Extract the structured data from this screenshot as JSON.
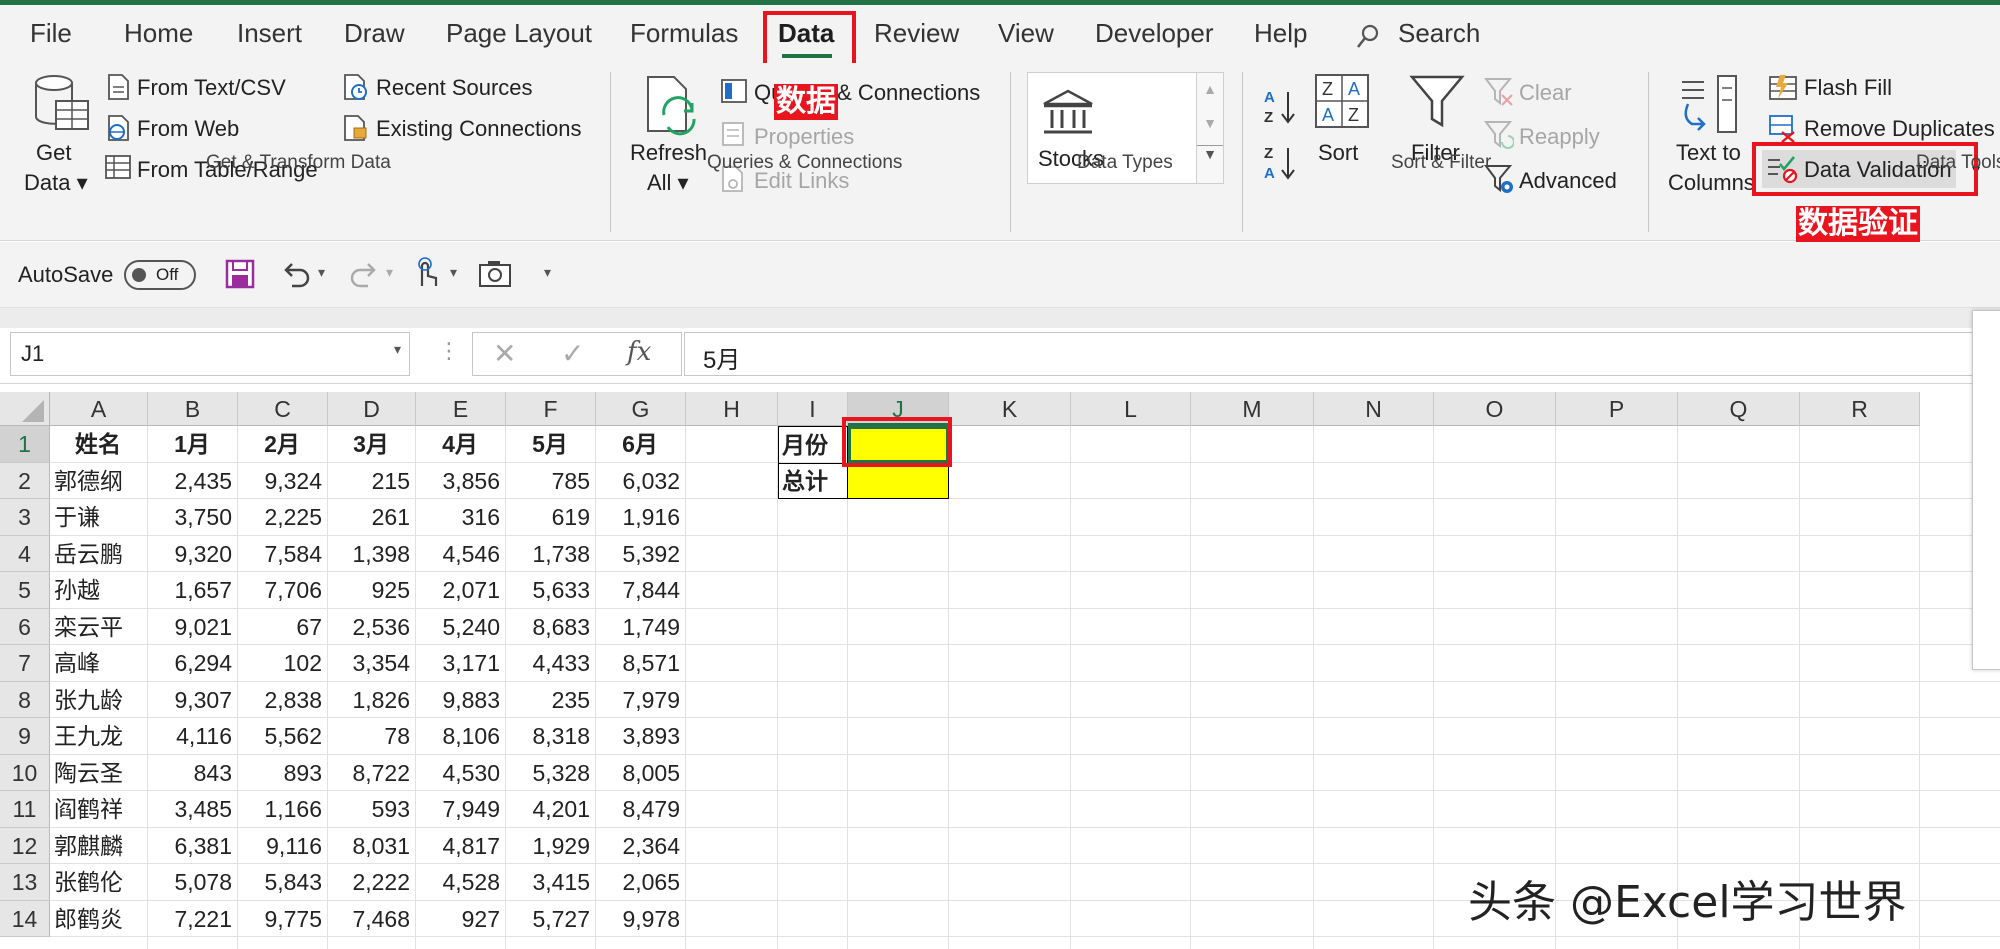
{
  "tabs": [
    "File",
    "Home",
    "Insert",
    "Draw",
    "Page Layout",
    "Formulas",
    "Data",
    "Review",
    "View",
    "Developer",
    "Help",
    "Search"
  ],
  "annotations": {
    "data_tab": "数据",
    "data_validation": "数据验证"
  },
  "ribbon": {
    "get_transform": {
      "get_data_1": "Get",
      "get_data_2": "Data ▾",
      "from_text_csv": "From Text/CSV",
      "from_web": "From Web",
      "from_table_range": "From Table/Range",
      "recent_sources": "Recent Sources",
      "existing_connections": "Existing Connections",
      "label": "Get & Transform Data"
    },
    "queries": {
      "refresh_1": "Refresh",
      "refresh_2": "All ▾",
      "queries_connections": "Queries & Connections",
      "properties": "Properties",
      "edit_links": "Edit Links",
      "label": "Queries & Connections"
    },
    "data_types": {
      "stocks": "Stocks",
      "label": "Data Types"
    },
    "sort_filter": {
      "sort": "Sort",
      "filter": "Filter",
      "clear": "Clear",
      "reapply": "Reapply",
      "advanced": "Advanced",
      "label": "Sort & Filter"
    },
    "data_tools": {
      "text_to_1": "Text to",
      "text_to_2": "Columns",
      "flash_fill": "Flash Fill",
      "remove_duplicates": "Remove Duplicates",
      "data_validation": "Data Validation",
      "label": "Data Tools"
    }
  },
  "qat": {
    "autosave": "AutoSave",
    "toggle": "Off"
  },
  "formula_bar": {
    "name_box": "J1",
    "formula": "5月",
    "fx": "fx"
  },
  "columns": [
    "A",
    "B",
    "C",
    "D",
    "E",
    "F",
    "G",
    "H",
    "I",
    "J",
    "K",
    "L",
    "M",
    "N",
    "O",
    "P",
    "Q",
    "R"
  ],
  "rows": [
    "1",
    "2",
    "3",
    "4",
    "5",
    "6",
    "7",
    "8",
    "9",
    "10",
    "11",
    "12",
    "13",
    "14"
  ],
  "table": {
    "headers": [
      "姓名",
      "1月",
      "2月",
      "3月",
      "4月",
      "5月",
      "6月"
    ],
    "data": [
      [
        "郭德纲",
        "2,435",
        "9,324",
        "215",
        "3,856",
        "785",
        "6,032"
      ],
      [
        "于谦",
        "3,750",
        "2,225",
        "261",
        "316",
        "619",
        "1,916"
      ],
      [
        "岳云鹏",
        "9,320",
        "7,584",
        "1,398",
        "4,546",
        "1,738",
        "5,392"
      ],
      [
        "孙越",
        "1,657",
        "7,706",
        "925",
        "2,071",
        "5,633",
        "7,844"
      ],
      [
        "栾云平",
        "9,021",
        "67",
        "2,536",
        "5,240",
        "8,683",
        "1,749"
      ],
      [
        "高峰",
        "6,294",
        "102",
        "3,354",
        "3,171",
        "4,433",
        "8,571"
      ],
      [
        "张九龄",
        "9,307",
        "2,838",
        "1,826",
        "9,883",
        "235",
        "7,979"
      ],
      [
        "王九龙",
        "4,116",
        "5,562",
        "78",
        "8,106",
        "8,318",
        "3,893"
      ],
      [
        "陶云圣",
        "843",
        "893",
        "8,722",
        "4,530",
        "5,328",
        "8,005"
      ],
      [
        "阎鹤祥",
        "3,485",
        "1,166",
        "593",
        "7,949",
        "4,201",
        "8,479"
      ],
      [
        "郭麒麟",
        "6,381",
        "9,116",
        "8,031",
        "4,817",
        "1,929",
        "2,364"
      ],
      [
        "张鹤伦",
        "5,078",
        "5,843",
        "2,222",
        "4,528",
        "3,415",
        "2,065"
      ],
      [
        "郎鹤炎",
        "7,221",
        "9,775",
        "7,468",
        "927",
        "5,727",
        "9,978"
      ]
    ]
  },
  "side_table": {
    "month_label": "月份",
    "total_label": "总计"
  },
  "watermark": "头条 @Excel学习世界",
  "colors": {
    "excel_green": "#217346",
    "highlight_red": "#e8141e",
    "yellow": "#ffff00"
  }
}
